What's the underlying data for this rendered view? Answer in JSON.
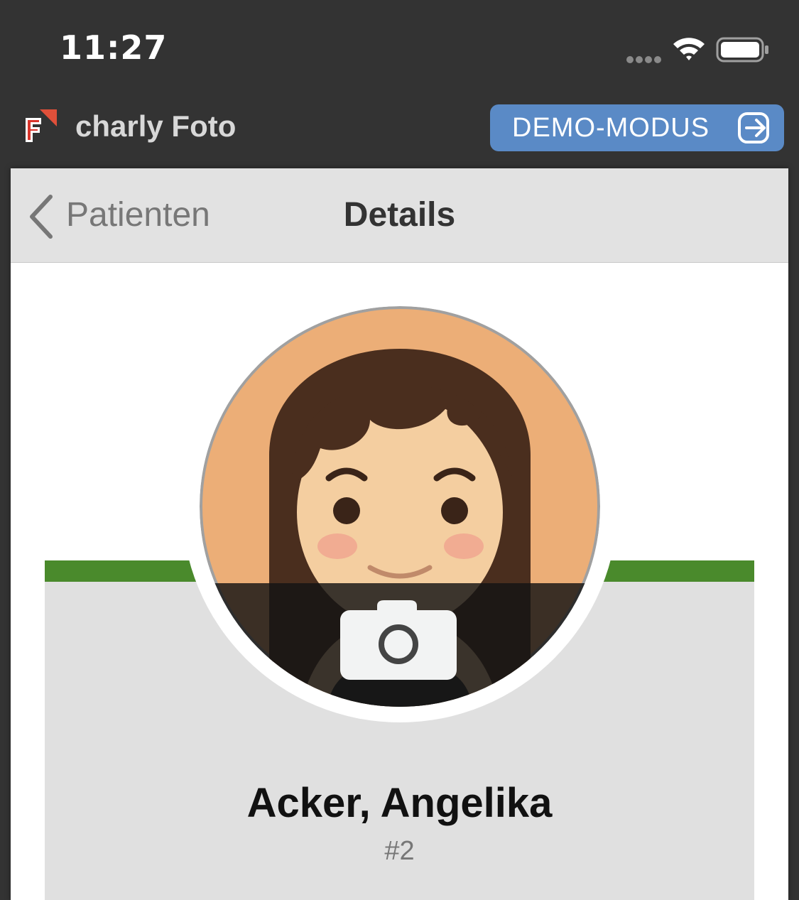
{
  "status_bar": {
    "time": "11:27",
    "wifi_icon": "wifi-icon",
    "battery_icon": "battery-icon"
  },
  "app_header": {
    "logo_icon": "charly-logo",
    "title": "charly Foto",
    "demo_button": {
      "label": "DEMO-MODUS",
      "icon": "exit-icon",
      "color": "#5a8ac6"
    }
  },
  "nav": {
    "back_label": "Patienten",
    "title": "Details"
  },
  "patient": {
    "name": "Acker, Angelika",
    "number": "#2",
    "avatar_icon": "female-avatar",
    "camera_icon": "camera-icon",
    "accent_color": "#4a8a2c"
  }
}
